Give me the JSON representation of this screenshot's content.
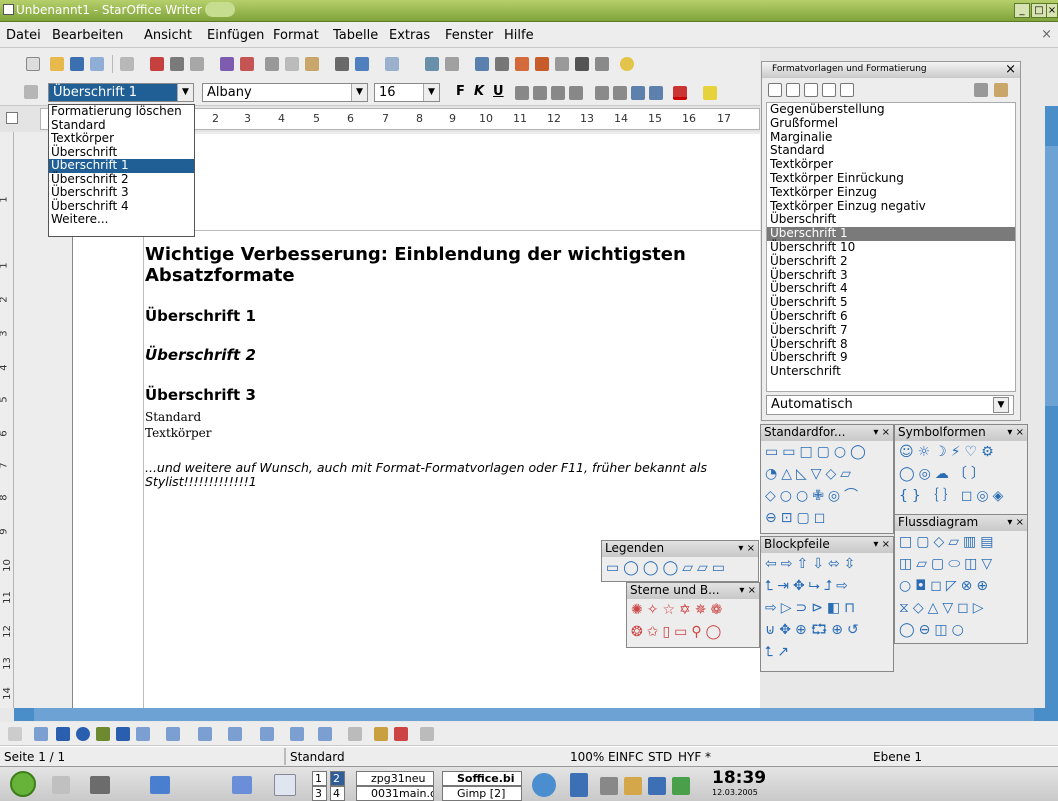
{
  "window": {
    "title": "Unbenannt1 - StarOffice Writer",
    "min": "_",
    "max": "□",
    "close": "×"
  },
  "menu": [
    "Datei",
    "Bearbeiten",
    "Ansicht",
    "Einfügen",
    "Format",
    "Tabelle",
    "Extras",
    "Fenster",
    "Hilfe"
  ],
  "menu_close": "×",
  "formatbar": {
    "style_value": "Überschrift 1",
    "font_value": "Albany",
    "size_value": "16",
    "bold": "F",
    "italic": "K",
    "underline": "U"
  },
  "style_dropdown": [
    "Formatierung löschen",
    "Standard",
    "Textkörper",
    "Überschrift",
    "Überschrift 1",
    "Überschrift 2",
    "Überschrift 3",
    "Überschrift 4",
    "Weitere..."
  ],
  "style_dropdown_selected": 4,
  "ruler_marks": [
    "2",
    "3",
    "4",
    "5",
    "6",
    "7",
    "8",
    "9",
    "10",
    "11",
    "12",
    "13",
    "14",
    "15",
    "16",
    "17"
  ],
  "vruler_marks": [
    "1",
    "1",
    "2",
    "3",
    "4",
    "5",
    "6",
    "7",
    "8",
    "9",
    "10",
    "11",
    "12",
    "13",
    "14"
  ],
  "document": {
    "heading_main": "Wichtige Verbesserung: Einblendung der wichtigsten Absatzformate",
    "h1": "Überschrift 1",
    "h2": "Überschrift 2",
    "h3": "Überschrift 3",
    "standard": "Standard",
    "textkoerper": "Textkörper",
    "note": "...und weitere auf Wunsch, auch mit Format-Formatvorlagen oder F11, früher bekannt als Stylist!!!!!!!!!!!!!1"
  },
  "stylist": {
    "title": "Formatvorlagen und Formatierung",
    "close": "×",
    "items": [
      "Gegenüberstellung",
      "Grußformel",
      "Marginalie",
      "Standard",
      "Textkörper",
      "Textkörper Einrückung",
      "Textkörper Einzug",
      "Textkörper Einzug negativ",
      "Überschrift",
      "Überschrift 1",
      "Überschrift 10",
      "Überschrift 2",
      "Überschrift 3",
      "Überschrift 4",
      "Überschrift 5",
      "Überschrift 6",
      "Überschrift 7",
      "Überschrift 8",
      "Überschrift 9",
      "Unterschrift"
    ],
    "selected": 9,
    "filter": "Automatisch"
  },
  "palettes": {
    "standardformen": {
      "title": "Standardfor...",
      "close": "▾ ×"
    },
    "symbolformen": {
      "title": "Symbolformen",
      "close": "▾ ×"
    },
    "blockpfeile": {
      "title": "Blockpfeile",
      "close": "▾ ×"
    },
    "flussdiagramm": {
      "title": "Flussdiagram",
      "close": "▾ ×"
    },
    "legenden": {
      "title": "Legenden",
      "close": "▾ ×"
    },
    "sterne": {
      "title": "Sterne und B...",
      "close": "▾ ×"
    }
  },
  "statusbar": {
    "page": "Seite 1 / 1",
    "style": "Standard",
    "zoom": "100%",
    "mode1": "EINFC",
    "mode2": "STD",
    "mode3": "HYF",
    "star": "*",
    "layer": "Ebene 1"
  },
  "taskbar": {
    "desktops": [
      "1",
      "2",
      "3",
      "4"
    ],
    "tasks": [
      "zpg31neu",
      "0031main.c",
      "Soffice.bi",
      "Gimp [2]"
    ],
    "time": "18:39",
    "date": "12.03.2005"
  },
  "colors": {
    "selection": "#1f5f95",
    "title_green": "#8cae45",
    "scroll_blue": "#4a8ec9"
  }
}
